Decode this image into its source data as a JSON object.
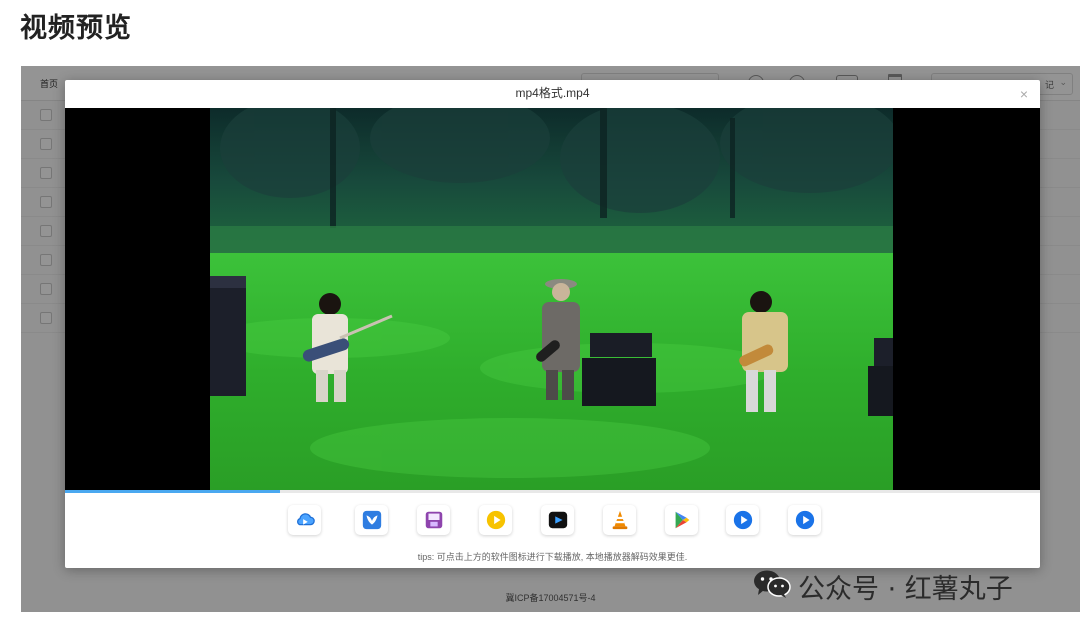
{
  "page": {
    "title": "视频预览"
  },
  "background_app": {
    "home_label": "首页",
    "select_value": "记",
    "footer_text": "冀ICP备17004571号-4"
  },
  "dialog": {
    "title": "mp4格式.mp4",
    "close_symbol": "×",
    "progress": 0.22,
    "players": [
      {
        "icon": "cloud-player-icon",
        "color": "#3a8ee6"
      },
      {
        "icon": "bird-player-icon",
        "color": "#2f7de1"
      },
      {
        "icon": "save-player-icon",
        "color": "#8e44ad"
      },
      {
        "icon": "yellow-play-icon",
        "color": "#f7c300"
      },
      {
        "icon": "dark-player-icon",
        "color": "#111111"
      },
      {
        "icon": "vlc-cone-icon",
        "color": "#f08a00"
      },
      {
        "icon": "google-play-icon",
        "color": "#34a853"
      },
      {
        "icon": "blue-play-icon",
        "color": "#1a73e8"
      },
      {
        "icon": "blue-play-icon-2",
        "color": "#1a73e8"
      }
    ],
    "tips": "tips: 可点击上方的软件图标进行下载播放, 本地播放器解码效果更佳."
  },
  "watermark": {
    "text": "公众号 · 红薯丸子"
  }
}
